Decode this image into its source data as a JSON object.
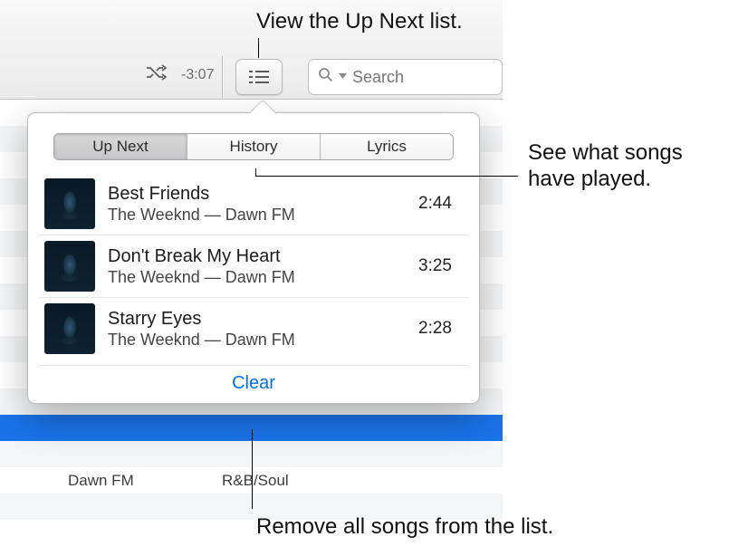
{
  "callouts": {
    "top": "View the Up Next list.",
    "right": "See what songs\nhave played.",
    "bottom": "Remove all songs from the list."
  },
  "toolbar": {
    "time_remaining": "-3:07",
    "search_placeholder": "Search"
  },
  "popover": {
    "tabs": {
      "up_next": "Up Next",
      "history": "History",
      "lyrics": "Lyrics"
    },
    "tracks": [
      {
        "title": "Best Friends",
        "artist": "The Weeknd — Dawn FM",
        "duration": "2:44"
      },
      {
        "title": "Don't Break My Heart",
        "artist": "The Weeknd — Dawn FM",
        "duration": "3:25"
      },
      {
        "title": "Starry Eyes",
        "artist": "The Weeknd — Dawn FM",
        "duration": "2:28"
      }
    ],
    "clear_label": "Clear"
  },
  "background_row": {
    "album": "Dawn FM",
    "genre": "R&B/Soul"
  }
}
